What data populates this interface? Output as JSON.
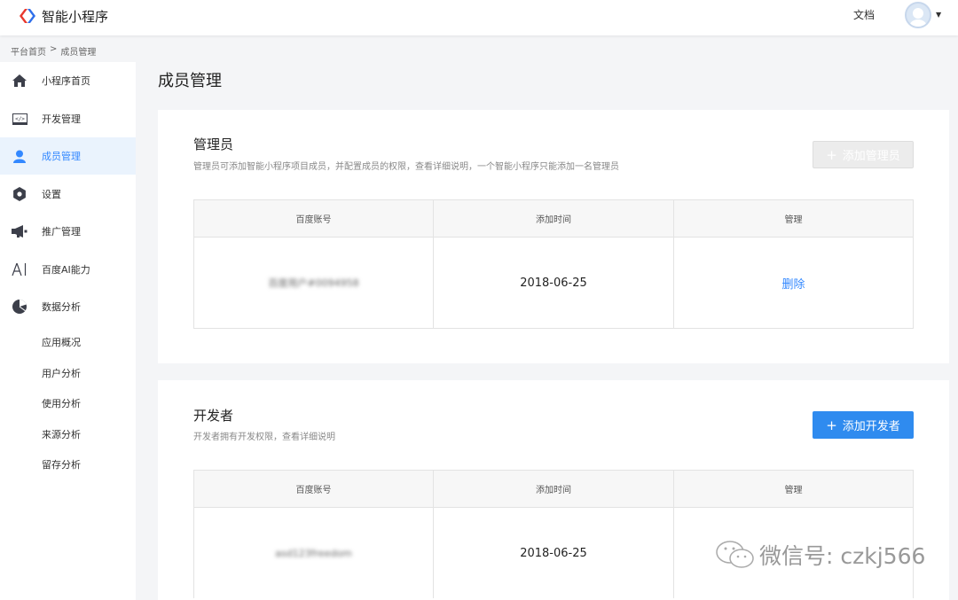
{
  "header": {
    "app_title": "智能小程序",
    "docs_link": "文档",
    "colors": {
      "brand_blue": "#2f6fea",
      "brand_red": "#e8392e"
    }
  },
  "breadcrumb": {
    "home": "平台首页",
    "separator": ">",
    "current": "成员管理"
  },
  "sidebar": {
    "items": [
      {
        "label": "小程序首页",
        "icon": "home-icon"
      },
      {
        "label": "开发管理",
        "icon": "code-icon"
      },
      {
        "label": "成员管理",
        "icon": "user-icon",
        "active": true
      },
      {
        "label": "设置",
        "icon": "gear-icon"
      },
      {
        "label": "推广管理",
        "icon": "megaphone-icon"
      },
      {
        "label": "百度AI能力",
        "icon": "ai-icon"
      },
      {
        "label": "数据分析",
        "icon": "pie-chart-icon"
      }
    ],
    "subitems": [
      "应用概况",
      "用户分析",
      "使用分析",
      "来源分析",
      "留存分析"
    ]
  },
  "main": {
    "page_title": "成员管理",
    "admin_section": {
      "title": "管理员",
      "description": "管理员可添加智能小程序项目成员，并配置成员的权限，查看详细说明，一个智能小程序只能添加一名管理员",
      "button": "添加管理员",
      "table": {
        "headers": [
          "百度账号",
          "添加时间",
          "管理"
        ],
        "rows": [
          {
            "account": "百度用户#0094958",
            "date": "2018-06-25",
            "action": "删除"
          }
        ]
      }
    },
    "developer_section": {
      "title": "开发者",
      "description": "开发者拥有开发权限，查看详细说明",
      "button": "添加开发者",
      "table": {
        "headers": [
          "百度账号",
          "添加时间",
          "管理"
        ],
        "rows": [
          {
            "account": "asd123freedom",
            "date": "2018-06-25"
          }
        ]
      }
    }
  },
  "watermark": {
    "text": "微信号: czkj566"
  }
}
